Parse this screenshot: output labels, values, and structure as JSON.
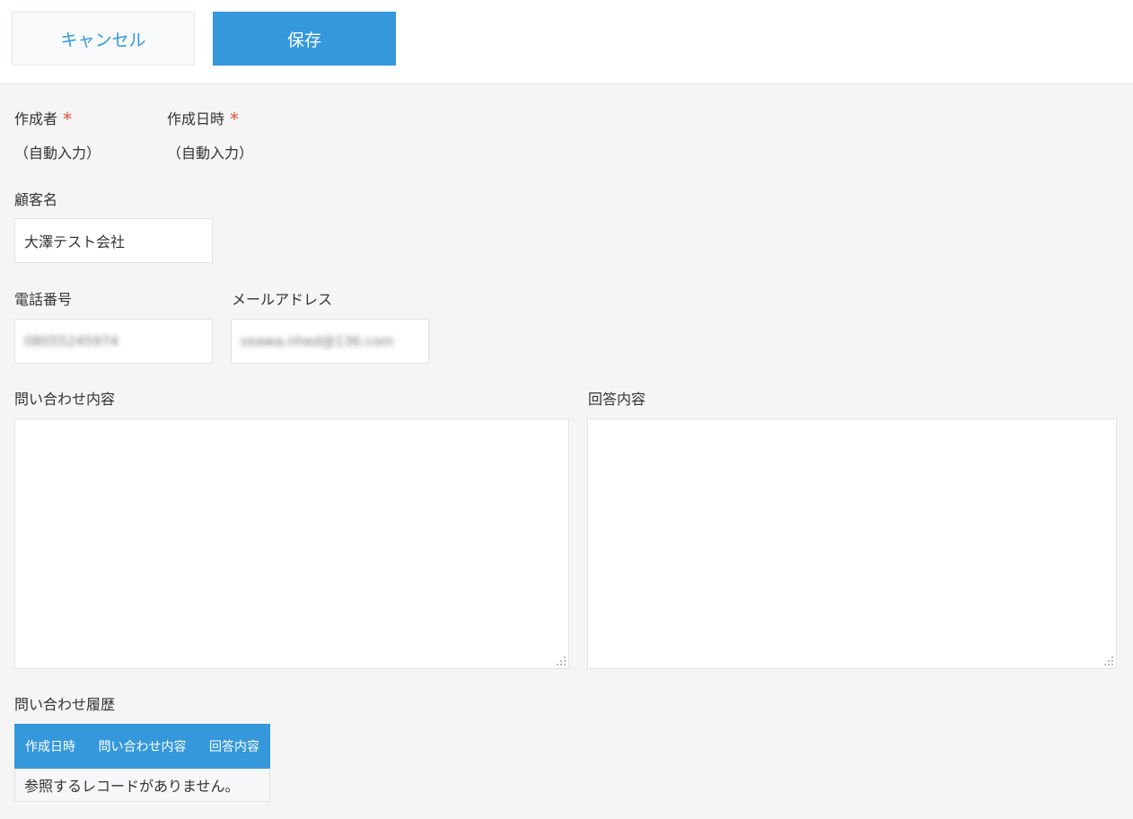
{
  "toolbar": {
    "cancel_label": "キャンセル",
    "save_label": "保存"
  },
  "fields": {
    "creator": {
      "label": "作成者",
      "required_mark": "*",
      "value": "（自動入力）"
    },
    "created_at": {
      "label": "作成日時",
      "required_mark": "*",
      "value": "（自動入力）"
    },
    "customer_name": {
      "label": "顧客名",
      "value": "大澤テスト会社"
    },
    "phone": {
      "label": "電話番号",
      "value": "08055245974"
    },
    "email": {
      "label": "メールアドレス",
      "value": "osawa.nhed@136.com"
    },
    "inquiry": {
      "label": "問い合わせ内容",
      "value": ""
    },
    "answer": {
      "label": "回答内容",
      "value": ""
    }
  },
  "history": {
    "label": "問い合わせ履歴",
    "columns": [
      "作成日時",
      "問い合わせ内容",
      "回答内容"
    ],
    "empty_message": "参照するレコードがありません。"
  },
  "colors": {
    "accent": "#3498db",
    "required": "#e74c3c"
  }
}
